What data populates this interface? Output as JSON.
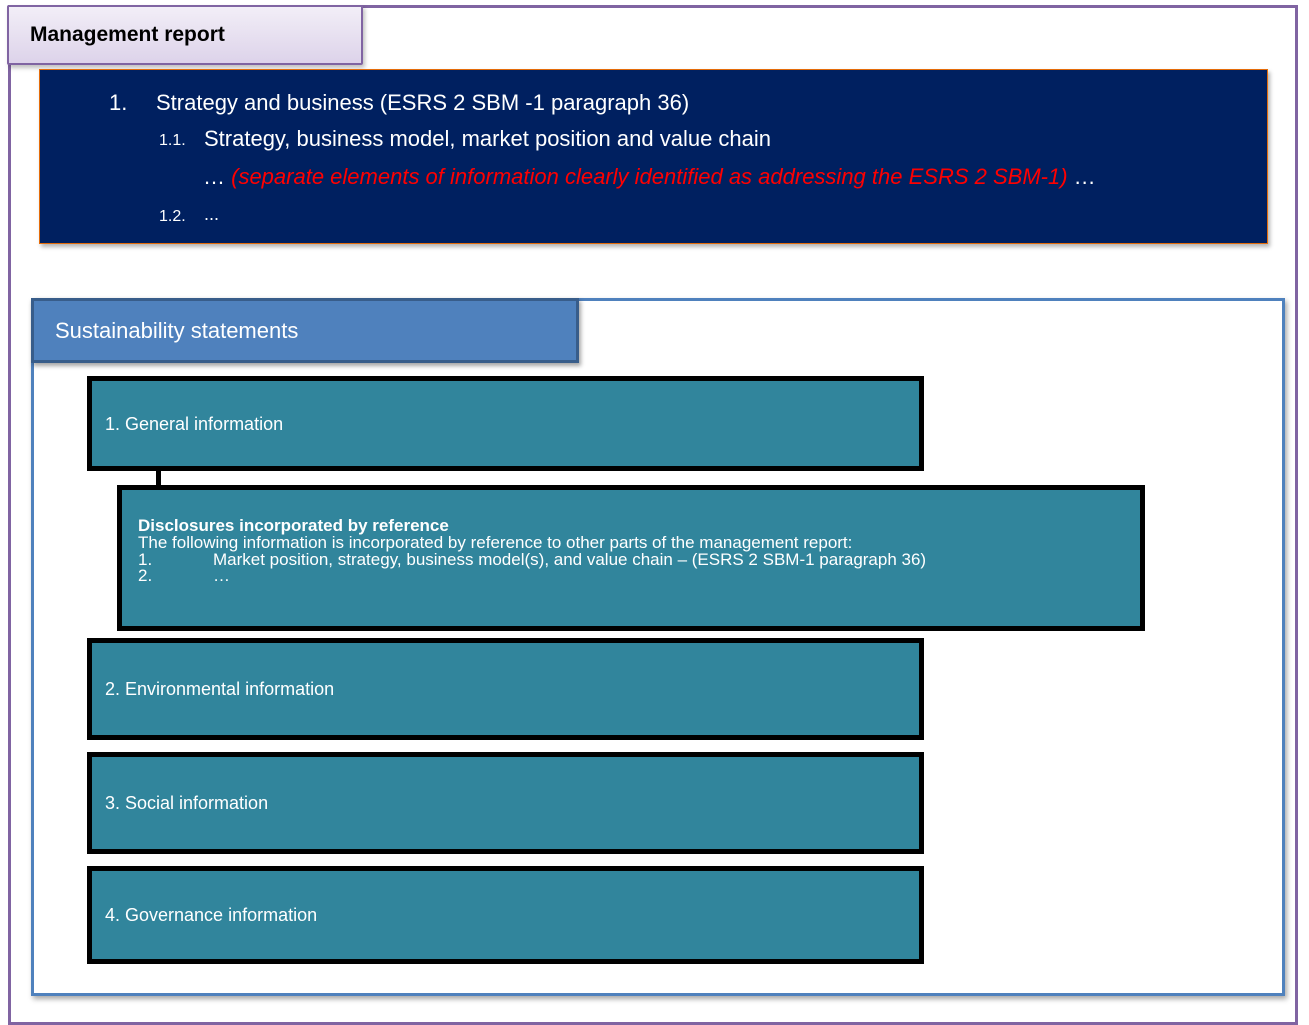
{
  "management_report": {
    "tab_label": "Management report",
    "item1_number": "1.",
    "item1_text": "Strategy and business (ESRS 2 SBM -1 paragraph 36)",
    "item11_number": "1.1.",
    "item11_text": "Strategy, business model, market position and value chain",
    "ellipsis_pre": "…",
    "separate_note": "(separate elements of information clearly identified as addressing the ESRS 2 SBM-1)",
    "ellipsis_post": "…",
    "item12_number": "1.2.",
    "item12_text": "..."
  },
  "sustainability": {
    "tab_label": "Sustainability statements",
    "general": "1. General information",
    "reference": {
      "title": "Disclosures incorporated by reference",
      "intro": "The following information is incorporated by reference to other parts of the management report:",
      "item1_number": "1.",
      "item1_text": "Market position, strategy, business model(s), and value chain – (ESRS 2 SBM-1 paragraph 36)",
      "item2_number": "2.",
      "item2_text": "…"
    },
    "environmental": "2. Environmental information",
    "social": "3. Social information",
    "governance": "4. Governance information"
  },
  "colors": {
    "frame_purple": "#8064a2",
    "navy": "#002060",
    "steel_blue": "#4f81bd",
    "teal": "#31859c",
    "note_red": "#ff0000"
  }
}
